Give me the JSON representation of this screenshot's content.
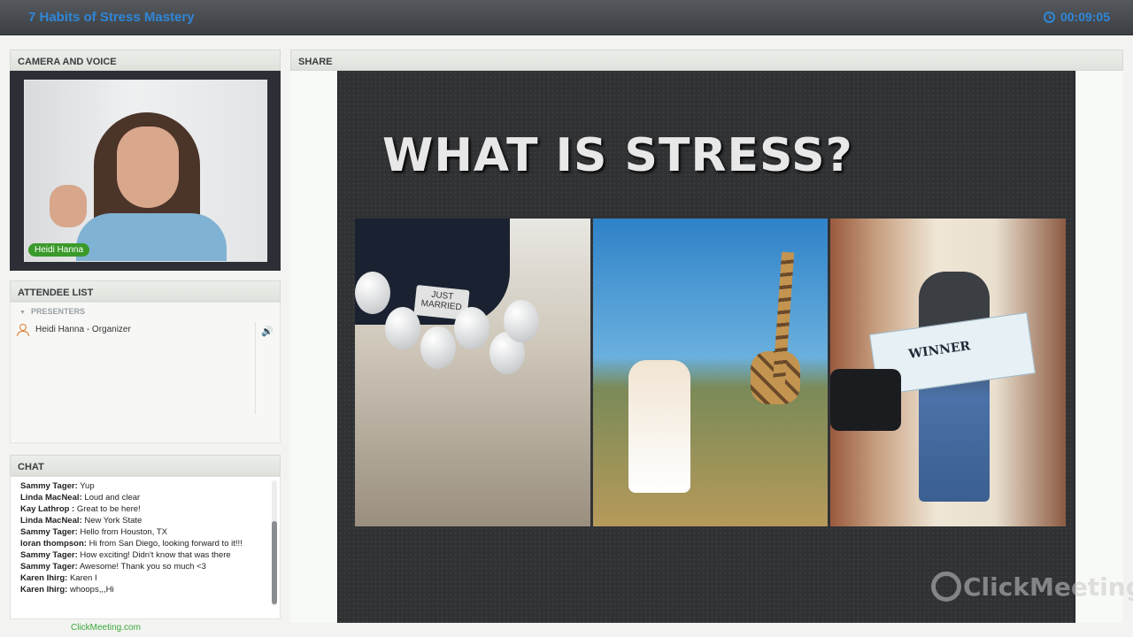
{
  "header": {
    "title": "7 Habits of Stress Mastery",
    "timer": "00:09:05",
    "clock_icon": "clock-icon"
  },
  "camera_panel": {
    "heading": "CAMERA AND VOICE",
    "presenter_name": "Heidi Hanna"
  },
  "attendee_panel": {
    "heading": "ATTENDEE LIST",
    "section": "PRESENTERS",
    "attendees": [
      {
        "name": "Heidi Hanna  - Organizer",
        "icon": "user-icon",
        "audio": "speaker-icon"
      }
    ]
  },
  "chat_panel": {
    "heading": "CHAT",
    "messages": [
      {
        "sender": "Sammy Tager:",
        "text": "Yup"
      },
      {
        "sender": "Linda  MacNeal:",
        "text": "Loud and clear"
      },
      {
        "sender": "Kay Lathrop :",
        "text": "Great to be here!"
      },
      {
        "sender": "Linda  MacNeal:",
        "text": "New York State"
      },
      {
        "sender": "Sammy Tager:",
        "text": "Hello from Houston, TX"
      },
      {
        "sender": "loran thompson:",
        "text": "Hi from San Diego, looking forward to it!!!"
      },
      {
        "sender": "Sammy Tager:",
        "text": "How exciting! Didn't know that was there"
      },
      {
        "sender": "Sammy Tager:",
        "text": "Awesome! Thank you so much <3"
      },
      {
        "sender": "Karen Ihirg:",
        "text": "Karen I"
      },
      {
        "sender": "Karen Ihirg:",
        "text": "whoops,,,Hi"
      }
    ]
  },
  "share_panel": {
    "heading": "SHARE",
    "slide_title": "WHAT IS STRESS?",
    "sign_text": "JUST MARRIED",
    "check_text": "WINNER",
    "watermark": "ClickMeeting"
  },
  "footer": {
    "link": "ClickMeeting.com"
  },
  "colors": {
    "accent_blue": "#2f86d8",
    "green": "#3a9a2a"
  }
}
